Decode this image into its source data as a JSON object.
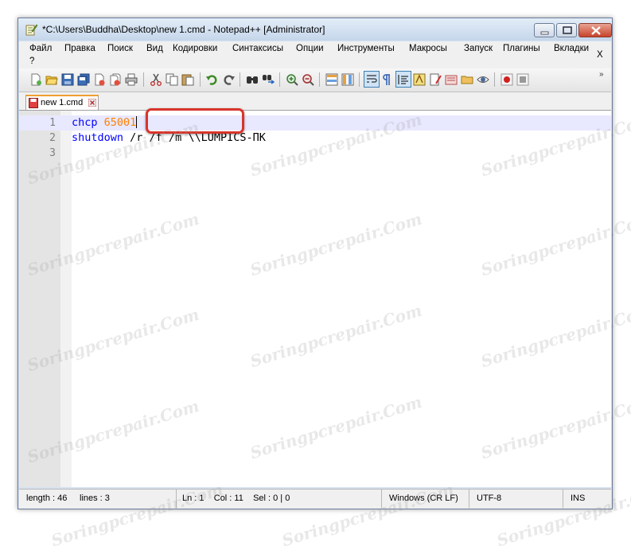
{
  "window": {
    "title": "*C:\\Users\\Buddha\\Desktop\\new 1.cmd - Notepad++ [Administrator]"
  },
  "menu": {
    "items": [
      "Файл",
      "Правка",
      "Поиск",
      "Вид",
      "Кодировки",
      "Синтаксисы",
      "Опции",
      "Инструменты",
      "Макросы",
      "Запуск",
      "Плагины",
      "Вкладки",
      "?"
    ],
    "close_doc": "X"
  },
  "toolbar": {
    "icons": [
      "new-file",
      "open-file",
      "save",
      "save-all",
      "close",
      "close-all",
      "print",
      "cut",
      "copy",
      "paste",
      "undo",
      "redo",
      "find",
      "replace",
      "zoom-in",
      "zoom-out",
      "sync-vertical",
      "sync-horizontal",
      "word-wrap",
      "show-all-characters",
      "indent-guide",
      "user-defined-language",
      "document-map",
      "function-list",
      "folder-as-workspace",
      "monitoring",
      "record-macro"
    ],
    "overflow": "»"
  },
  "tab": {
    "label": "new 1.cmd"
  },
  "editor": {
    "lines": [
      {
        "number": "1",
        "keyword": "chcp",
        "rest": "65001"
      },
      {
        "number": "2",
        "keyword": "shutdown",
        "rest": "/r /f /m \\\\LUMPICS-ПК"
      },
      {
        "number": "3",
        "keyword": "",
        "rest": ""
      }
    ]
  },
  "status": {
    "length": "length : 46",
    "lines": "lines : 3",
    "position": "Ln : 1    Col : 11    Sel : 0 | 0",
    "eol": "Windows (CR LF)",
    "encoding": "UTF-8",
    "mode": "INS"
  },
  "watermark": "Soringpcrepair.Com",
  "colors": {
    "keyword": "#0000ff",
    "number": "#ff8000",
    "highlight_border": "#d9342b",
    "current_line": "#e8e8ff"
  }
}
